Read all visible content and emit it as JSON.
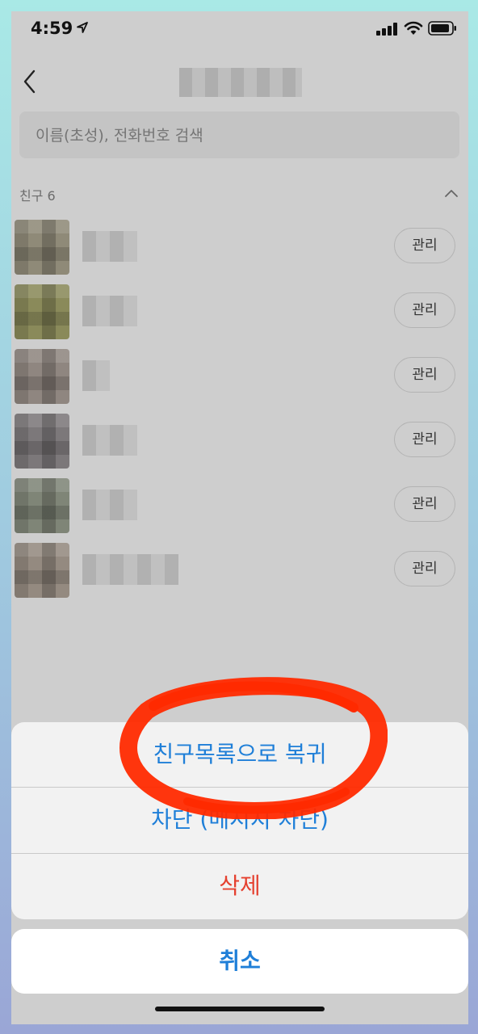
{
  "status_bar": {
    "time": "4:59"
  },
  "search": {
    "placeholder": "이름(초성), 전화번호 검색"
  },
  "section": {
    "label": "친구 6"
  },
  "friends": [
    {
      "manage_label": "관리",
      "name_blur_w": 68
    },
    {
      "manage_label": "관리",
      "name_blur_w": 68
    },
    {
      "manage_label": "관리",
      "name_blur_w": 34
    },
    {
      "manage_label": "관리",
      "name_blur_w": 68
    },
    {
      "manage_label": "관리",
      "name_blur_w": 68
    },
    {
      "manage_label": "관리",
      "name_blur_w": 119
    }
  ],
  "action_sheet": {
    "restore_label": "친구목록으로 복귀",
    "block_label": "차단 (메시지 차단)",
    "delete_label": "삭제",
    "cancel_label": "취소"
  },
  "colors": {
    "accent": "#1f7fd8",
    "danger": "#e5402f",
    "annotation": "#ff2a00"
  }
}
